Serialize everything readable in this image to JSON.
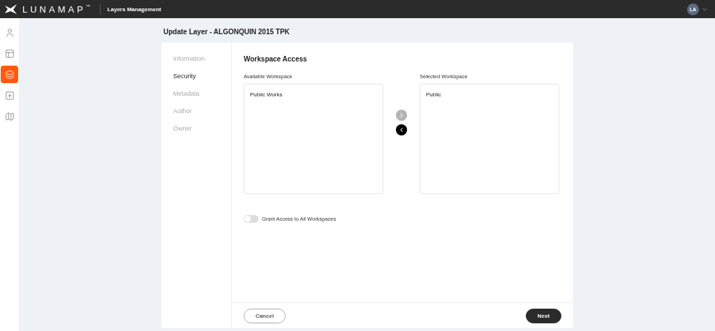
{
  "header": {
    "logo": "LUNAMAP",
    "trademark": "™",
    "section": "Layers Management",
    "avatar": "LA"
  },
  "sidebar": {
    "items": [
      {
        "kind": "user",
        "selected": false
      },
      {
        "kind": "layout",
        "selected": false
      },
      {
        "kind": "layers",
        "selected": true
      },
      {
        "kind": "add",
        "selected": false
      },
      {
        "kind": "map",
        "selected": false
      }
    ]
  },
  "page_title": "Update Layer - ALGONQUIN 2015 TPK",
  "steps": [
    {
      "label": "Information",
      "selected": false
    },
    {
      "label": "Security",
      "selected": true
    },
    {
      "label": "Metadata",
      "selected": false
    },
    {
      "label": "Author",
      "selected": false
    },
    {
      "label": "Owner",
      "selected": false
    }
  ],
  "section_title": "Workspace Access",
  "available": {
    "label": "Available Workspace",
    "items": [
      "Public Works"
    ]
  },
  "selected": {
    "label": "Selected Workspace",
    "items": [
      "Public"
    ]
  },
  "transfer_buttons": [
    {
      "kind": "right",
      "disabled": true
    },
    {
      "kind": "left",
      "disabled": false
    }
  ],
  "grant_all": {
    "label": "Grant Access to All Workspaces",
    "on": false
  },
  "buttons": [
    {
      "label": "Cancel",
      "kind": "secondary"
    },
    {
      "label": "Next",
      "kind": "primary"
    }
  ]
}
